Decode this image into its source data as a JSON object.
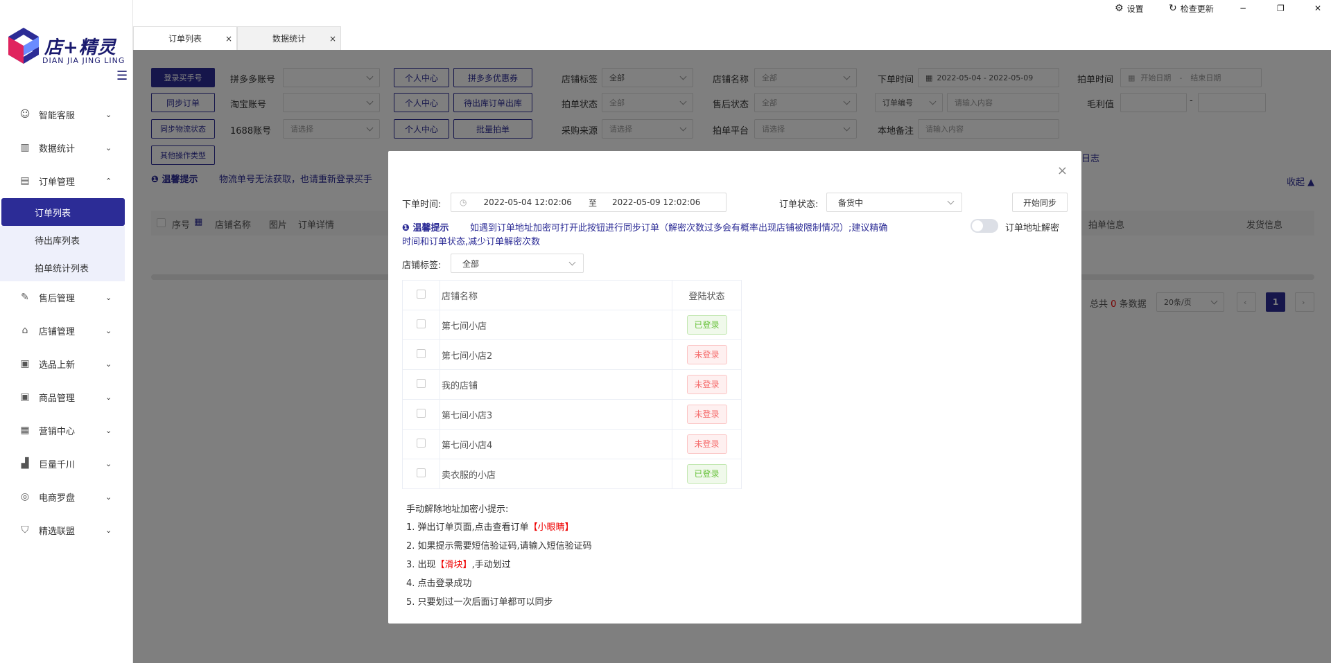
{
  "app": {
    "logo_text": "店+精灵",
    "logo_sub": "DIAN JIA JING LING"
  },
  "topbar": {
    "settings_label": "设置",
    "update_label": "检查更新",
    "minimize": "−",
    "restore": "❐",
    "close": "✕"
  },
  "tabs": [
    {
      "label": "订单列表",
      "close": "×"
    },
    {
      "label": "数据统计",
      "close": "×"
    }
  ],
  "sidebar": {
    "items": [
      {
        "label": "智能客服",
        "icon": "robot-icon"
      },
      {
        "label": "数据统计",
        "icon": "bar-chart-icon"
      },
      {
        "label": "订单管理",
        "icon": "clipboard-icon"
      },
      {
        "label": "售后管理",
        "icon": "edit-doc-icon"
      },
      {
        "label": "店铺管理",
        "icon": "store-icon"
      },
      {
        "label": "选品上新",
        "icon": "product-icon"
      },
      {
        "label": "商品管理",
        "icon": "goods-icon"
      },
      {
        "label": "营销中心",
        "icon": "marketing-icon"
      },
      {
        "label": "巨量千川",
        "icon": "signal-icon"
      },
      {
        "label": "电商罗盘",
        "icon": "compass-icon"
      },
      {
        "label": "精选联盟",
        "icon": "shield-icon"
      }
    ],
    "sub_items": [
      "订单列表",
      "待出库列表",
      "拍单统计列表"
    ]
  },
  "filters": {
    "btn_login": "登录买手号",
    "btn_sync_order": "同步订单",
    "btn_sync_logistics": "同步物流状态",
    "btn_other": "其他操作类型",
    "pdd_label": "拼多多账号",
    "taobao_label": "淘宝账号",
    "acc1688_label": "1688账号",
    "select_placeholder": "请选择",
    "personal_center": "个人中心",
    "btn_pdd_coupon": "拼多多优惠券",
    "btn_pending_out": "待出库订单出库",
    "btn_batch": "批量拍单",
    "store_tag_label": "店铺标签",
    "store_tag_value": "全部",
    "store_name_label": "店铺名称",
    "store_name_value": "全部",
    "order_time_label": "下单时间",
    "order_time_value": "2022-05-04  -  2022-05-09",
    "pai_time_label": "拍单时间",
    "pai_time_start": "开始日期",
    "pai_time_sep": "-",
    "pai_time_end": "结束日期",
    "pai_status_label": "拍单状态",
    "pai_status_value": "全部",
    "after_sale_label": "售后状态",
    "after_sale_value": "全部",
    "order_no_select": "订单编号",
    "input_placeholder": "请输入内容",
    "profit_label": "毛利值",
    "profit_sep": "-",
    "purchase_label": "采购来源",
    "platform_label": "拍单平台",
    "note_label": "本地备注",
    "log_text": "日志",
    "warn_title": "温馨提示",
    "warn_text": "物流单号无法获取，也请重新登录买手",
    "collapse_text": "收起"
  },
  "table_header": {
    "seq": "序号",
    "store": "店铺名称",
    "image": "图片",
    "detail": "订单详情",
    "pai_info": "拍单信息",
    "ship_info": "发货信息"
  },
  "pagination": {
    "total_prefix": "总共",
    "total": "0",
    "total_suffix": "条数据",
    "page_size": "20条/页",
    "current": "1"
  },
  "modal": {
    "close": "×",
    "time_label": "下单时间:",
    "time_start": "2022-05-04 12:02:06",
    "time_sep": "至",
    "time_end": "2022-05-09 12:02:06",
    "status_label": "订单状态:",
    "status_value": "备货中",
    "sync_btn": "开始同步",
    "tip_title": "温馨提示",
    "tip_text1": "如遇到订单地址加密可打开此按钮进行同步订单（解密次数过多会有概率出现店铺被限制情况）;建议精确",
    "tip_text2": "时间和订单状态,减少订单解密次数",
    "toggle_label": "订单地址解密",
    "store_tag_label": "店铺标签:",
    "store_tag_value": "全部",
    "table": {
      "col_name": "店铺名称",
      "col_status": "登陆状态",
      "rows": [
        {
          "name": "第七间小店",
          "status": "已登录",
          "ok": true
        },
        {
          "name": "第七间小店2",
          "status": "未登录",
          "ok": false
        },
        {
          "name": "我的店铺",
          "status": "未登录",
          "ok": false
        },
        {
          "name": "第七间小店3",
          "status": "未登录",
          "ok": false
        },
        {
          "name": "第七间小店4",
          "status": "未登录",
          "ok": false
        },
        {
          "name": "卖衣服的小店",
          "status": "已登录",
          "ok": true
        }
      ]
    },
    "hints_title": "手动解除地址加密小提示:",
    "hint1_a": "1. 弹出订单页面,点击查看订单",
    "hint1_b": "【小眼睛】",
    "hint2": "2. 如果提示需要短信验证码,请输入短信验证码",
    "hint3_a": "3. 出现",
    "hint3_b": "【滑块】",
    "hint3_c": ",手动划过",
    "hint4": "4. 点击登录成功",
    "hint5": "5. 只要划过一次后面订单都可以同步"
  }
}
